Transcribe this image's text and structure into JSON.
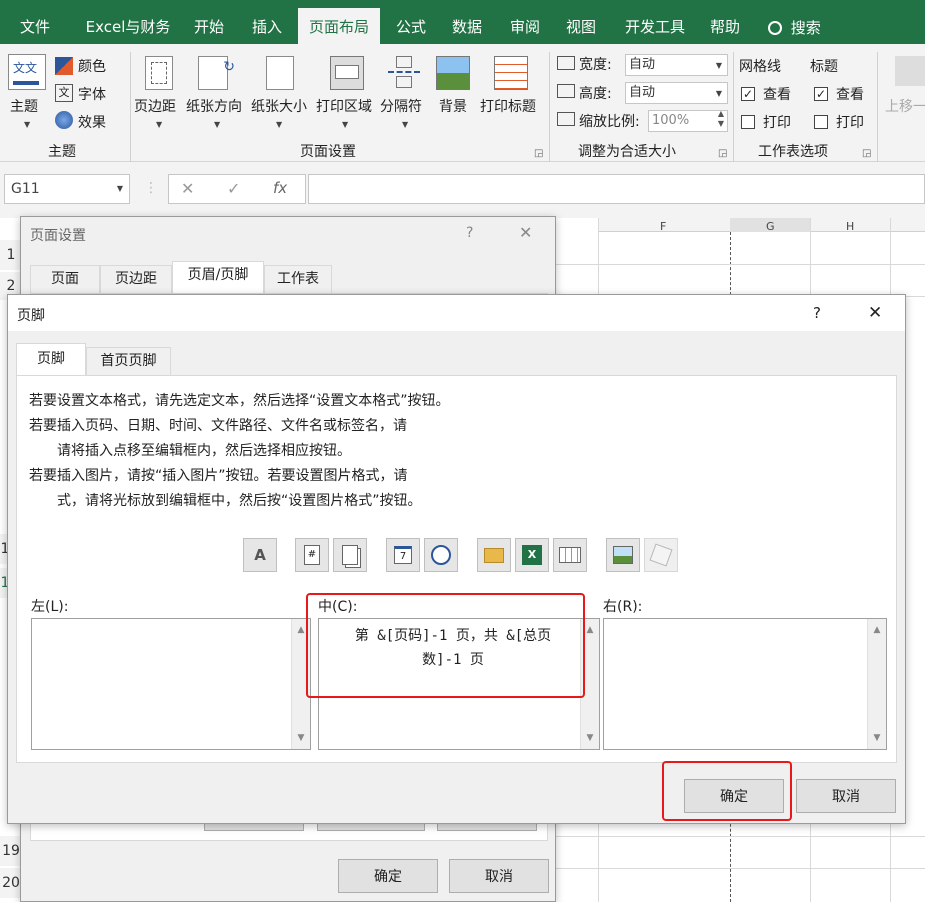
{
  "menu": {
    "tabs": [
      "文件",
      "Excel与财务",
      "开始",
      "插入",
      "页面布局",
      "公式",
      "数据",
      "审阅",
      "视图",
      "开发工具",
      "帮助"
    ],
    "search": "搜索"
  },
  "ribbon": {
    "theme": {
      "main": "主题",
      "colors": "颜色",
      "fonts": "字体",
      "effects": "效果",
      "group": "主题"
    },
    "pagesetup": {
      "margins": "页边距",
      "orientation": "纸张方向",
      "size": "纸张大小",
      "print_area": "打印区域",
      "breaks": "分隔符",
      "background": "背景",
      "print_titles": "打印标题",
      "group": "页面设置"
    },
    "scale": {
      "width_label": "宽度:",
      "width_value": "自动",
      "height_label": "高度:",
      "height_value": "自动",
      "scale_label": "缩放比例:",
      "scale_value": "100%",
      "group": "调整为合适大小"
    },
    "sheetopts": {
      "gridlines": "网格线",
      "headings": "标题",
      "view1": "查看",
      "view2": "查看",
      "print1": "打印",
      "print2": "打印",
      "group": "工作表选项"
    },
    "arrange": {
      "bring_forward": "上移一"
    }
  },
  "formula_bar": {
    "name_box": "G11",
    "fx": "fx"
  },
  "grid": {
    "col_headers": [
      "F",
      "G",
      "H"
    ],
    "row_numbers": [
      "1",
      "2",
      "1",
      "1",
      "1",
      "1",
      "1",
      "1",
      "1",
      "1",
      "19",
      "20"
    ]
  },
  "page_setup_dialog": {
    "title": "页面设置",
    "help": "?",
    "close": "✕",
    "tabs": [
      "页面",
      "页边距",
      "页眉/页脚",
      "工作表"
    ],
    "ok": "确定",
    "cancel": "取消"
  },
  "footer_dialog": {
    "title": "页脚",
    "help": "?",
    "close": "✕",
    "tabs": [
      "页脚",
      "首页页脚"
    ],
    "instructions": [
      "若要设置文本格式，请先选定文本，然后选择“设置文本格式”按钮。",
      "若要插入页码、日期、时间、文件路径、文件名或标签名，请",
      "请将插入点移至编辑框内，然后选择相应按钮。",
      "若要插入图片，请按“插入图片”按钮。若要设置图片格式，请",
      "式，请将光标放到编辑框中，然后按“设置图片格式”按钮。"
    ],
    "left_label": "左(L):",
    "center_label": "中(C):",
    "right_label": "右(R):",
    "center_text_line1": "第 &[页码]-1 页，共 &[总页",
    "center_text_line2": "数]-1 页",
    "ok": "确定",
    "cancel": "取消"
  },
  "colors": {
    "excel_green": "#217346",
    "highlight_red": "#e8191b"
  }
}
